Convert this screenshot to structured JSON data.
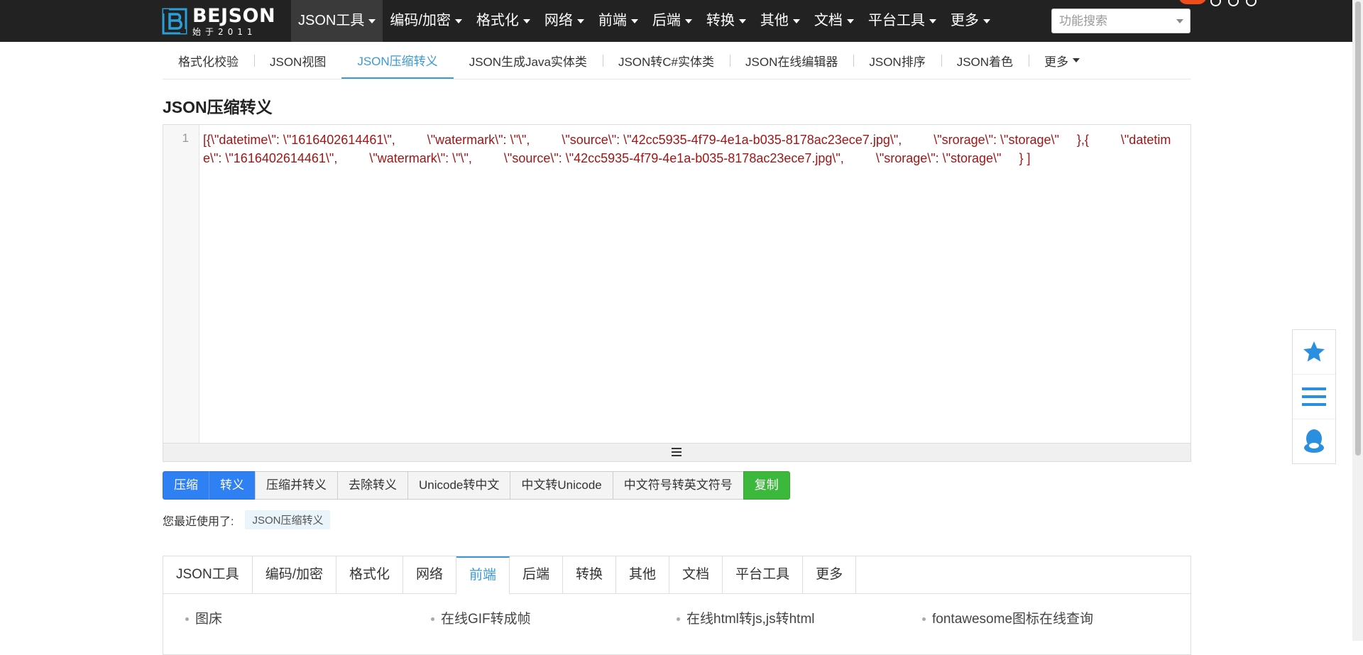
{
  "header": {
    "logo_title": "BEJSON",
    "logo_sub": "始于2011",
    "nav": [
      {
        "label": "JSON工具"
      },
      {
        "label": "编码/加密"
      },
      {
        "label": "格式化"
      },
      {
        "label": "网络"
      },
      {
        "label": "前端"
      },
      {
        "label": "后端"
      },
      {
        "label": "转换"
      },
      {
        "label": "其他"
      },
      {
        "label": "文档"
      },
      {
        "label": "平台工具"
      },
      {
        "label": "更多"
      }
    ],
    "search_placeholder": "功能搜索"
  },
  "subnav": {
    "items": [
      {
        "label": "格式化校验"
      },
      {
        "label": "JSON视图"
      },
      {
        "label": "JSON压缩转义"
      },
      {
        "label": "JSON生成Java实体类"
      },
      {
        "label": "JSON转C#实体类"
      },
      {
        "label": "JSON在线编辑器"
      },
      {
        "label": "JSON排序"
      },
      {
        "label": "JSON着色"
      },
      {
        "label": "更多"
      }
    ],
    "active": "JSON压缩转义"
  },
  "page_title": "JSON压缩转义",
  "editor": {
    "line_number": "1",
    "content": "[{\\\"datetime\\\": \\\"1616402614461\\\",         \\\"watermark\\\": \\\"\\\",         \\\"source\\\": \\\"42cc5935-4f79-4e1a-b035-8178ac23ece7.jpg\\\",         \\\"srorage\\\": \\\"storage\\\"     },{         \\\"datetime\\\": \\\"1616402614461\\\",         \\\"watermark\\\": \\\"\\\",         \\\"source\\\": \\\"42cc5935-4f79-4e1a-b035-8178ac23ece7.jpg\\\",         \\\"srorage\\\": \\\"storage\\\"     } ]"
  },
  "buttons": {
    "compress": "压缩",
    "escape": "转义",
    "compress_escape": "压缩并转义",
    "unescape": "去除转义",
    "unicode_to_cn": "Unicode转中文",
    "cn_to_unicode": "中文转Unicode",
    "cn_punct_to_en": "中文符号转英文符号",
    "copy": "复制"
  },
  "recent": {
    "label": "您最近使用了:",
    "items": [
      "JSON压缩转义"
    ]
  },
  "panel": {
    "tabs": [
      {
        "label": "JSON工具"
      },
      {
        "label": "编码/加密"
      },
      {
        "label": "格式化"
      },
      {
        "label": "网络"
      },
      {
        "label": "前端"
      },
      {
        "label": "后端"
      },
      {
        "label": "转换"
      },
      {
        "label": "其他"
      },
      {
        "label": "文档"
      },
      {
        "label": "平台工具"
      },
      {
        "label": "更多"
      }
    ],
    "active": "前端",
    "links": [
      "图床",
      "在线GIF转成帧",
      "在线html转js,js转html",
      "fontawesome图标在线查询"
    ]
  },
  "colors": {
    "nav_bg": "#222222",
    "accent": "#3a99d8",
    "primary_button": "#2f80f3",
    "success_button": "#3cb83c",
    "code_text": "#a31515"
  },
  "side_tools": [
    "star-icon",
    "menu-icon",
    "qq-icon"
  ]
}
